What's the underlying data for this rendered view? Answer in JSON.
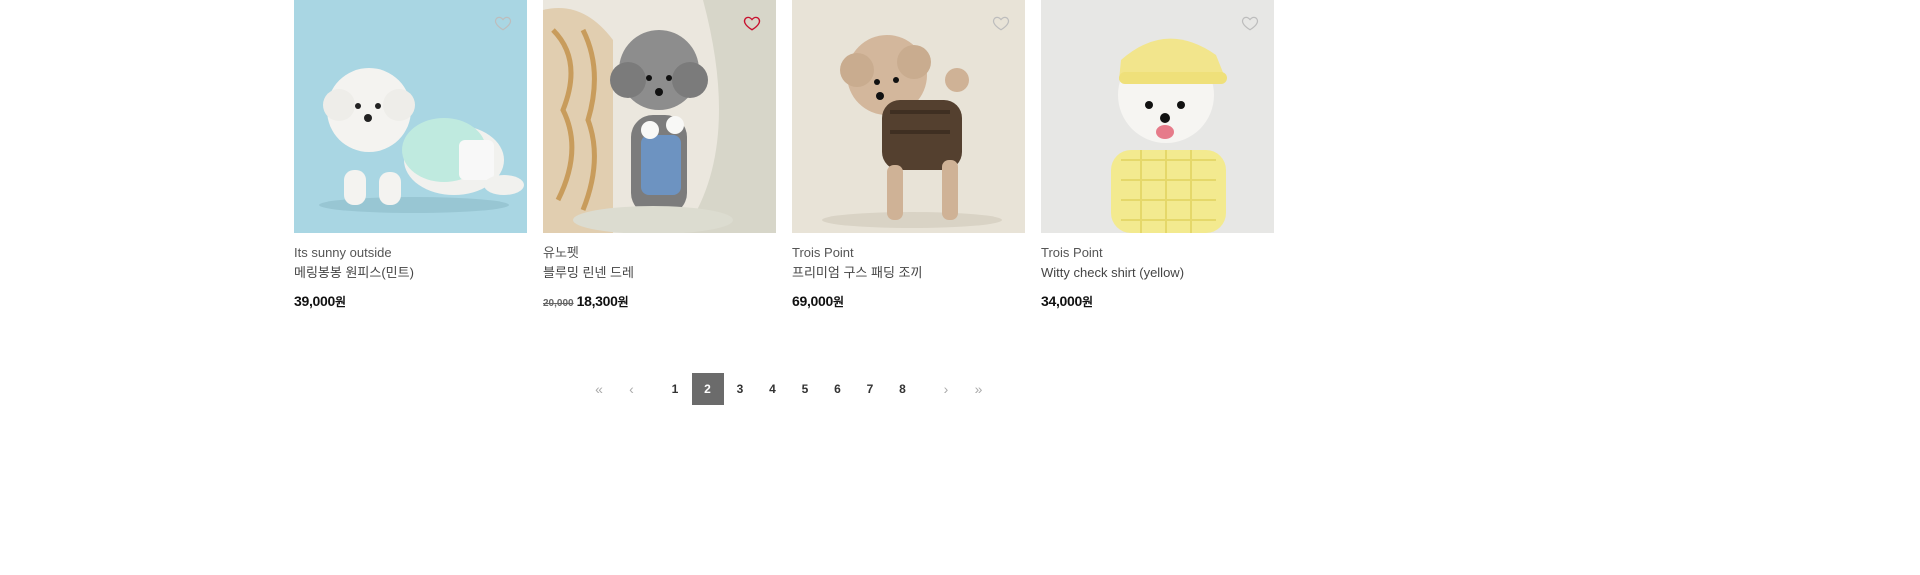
{
  "products": [
    {
      "brand": "Its sunny outside",
      "name": "메링봉봉 원피스(민트)",
      "price_old": "",
      "price": "39,000",
      "currency": "원",
      "wishlisted": false,
      "bg": "#a8d5e2"
    },
    {
      "brand": "유노펫",
      "name": "블루밍 린넨 드레",
      "price_old": "20,000",
      "price": "18,300",
      "currency": "원",
      "wishlisted": true,
      "bg": "#e9e5dc"
    },
    {
      "brand": "Trois Point",
      "name": "프리미엄 구스 패딩 조끼",
      "price_old": "",
      "price": "69,000",
      "currency": "원",
      "wishlisted": false,
      "bg": "#e8e3d8"
    },
    {
      "brand": "Trois Point",
      "name": "Witty check shirt (yellow)",
      "price_old": "",
      "price": "34,000",
      "currency": "원",
      "wishlisted": false,
      "bg": "#e6e6e4"
    }
  ],
  "pagination": {
    "first": "«",
    "prev": "‹",
    "pages": [
      "1",
      "2",
      "3",
      "4",
      "5",
      "6",
      "7",
      "8"
    ],
    "current": "2",
    "next": "›",
    "last": "»"
  },
  "colors": {
    "wish_active": "#c8102e",
    "wish_inactive": "#bdbdbd",
    "current_page_bg": "#6b6b6b"
  }
}
